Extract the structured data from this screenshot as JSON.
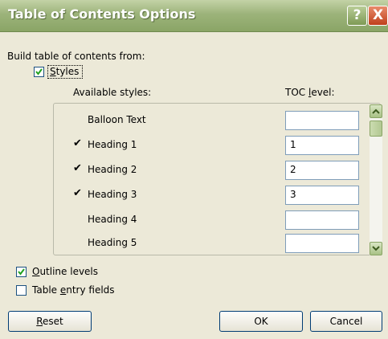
{
  "dialog": {
    "title": "Table of Contents Options",
    "help_glyph": "?",
    "close_glyph": "X"
  },
  "build_label": "Build table of contents from:",
  "styles_checkbox": {
    "label": "Styles",
    "checked": true
  },
  "columns": {
    "available_styles": "Available styles:",
    "toc_level": "TOC level:"
  },
  "styles": [
    {
      "name": "Balloon Text",
      "checked": false,
      "level": ""
    },
    {
      "name": "Heading 1",
      "checked": true,
      "level": "1"
    },
    {
      "name": "Heading 2",
      "checked": true,
      "level": "2"
    },
    {
      "name": "Heading 3",
      "checked": true,
      "level": "3"
    },
    {
      "name": "Heading 4",
      "checked": false,
      "level": ""
    },
    {
      "name": "Heading 5",
      "checked": false,
      "level": ""
    }
  ],
  "outline_levels": {
    "label": "Outline levels",
    "checked": true
  },
  "table_entry_fields": {
    "label": "Table entry fields",
    "checked": false
  },
  "buttons": {
    "reset": "Reset",
    "ok": "OK",
    "cancel": "Cancel"
  },
  "tick_glyph": "✔",
  "colors": {
    "title_bar": "#9cb37a",
    "close_button": "#c0401c",
    "dialog_bg": "#ece9d8"
  }
}
